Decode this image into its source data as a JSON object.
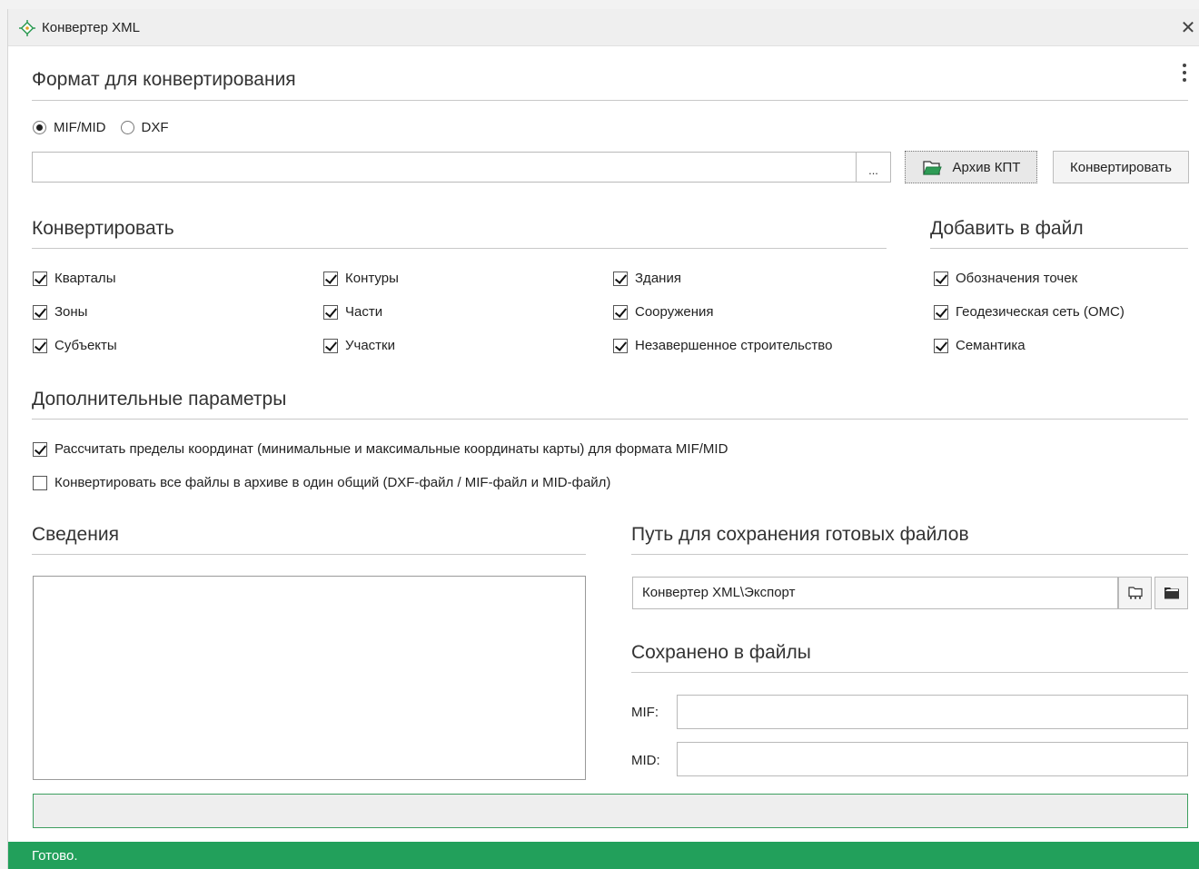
{
  "window": {
    "title": "Конвертер XML"
  },
  "format": {
    "heading": "Формат для конвертирования",
    "options": [
      {
        "label": "MIF/MID",
        "selected": true
      },
      {
        "label": "DXF",
        "selected": false
      }
    ],
    "file_path": "",
    "browse_label": "...",
    "archive_button": "Архив КПТ",
    "convert_button": "Конвертировать"
  },
  "convert": {
    "heading": "Конвертировать",
    "items": [
      {
        "label": "Кварталы",
        "checked": true
      },
      {
        "label": "Зоны",
        "checked": true
      },
      {
        "label": "Субъекты",
        "checked": true
      },
      {
        "label": "Контуры",
        "checked": true
      },
      {
        "label": "Части",
        "checked": true
      },
      {
        "label": "Участки",
        "checked": true
      },
      {
        "label": "Здания",
        "checked": true
      },
      {
        "label": "Сооружения",
        "checked": true
      },
      {
        "label": "Незавершенное строительство",
        "checked": true
      }
    ]
  },
  "add_to_file": {
    "heading": "Добавить в файл",
    "items": [
      {
        "label": "Обозначения точек",
        "checked": true
      },
      {
        "label": "Геодезическая сеть (ОМС)",
        "checked": true
      },
      {
        "label": "Семантика",
        "checked": true
      }
    ]
  },
  "extra": {
    "heading": "Дополнительные параметры",
    "items": [
      {
        "label": "Рассчитать пределы координат (минимальные и максимальные координаты карты) для формата MIF/MID",
        "checked": true
      },
      {
        "label": "Конвертировать все файлы в архиве в один общий (DXF-файл / MIF-файл и MID-файл)",
        "checked": false
      }
    ]
  },
  "info": {
    "heading": "Сведения",
    "text": ""
  },
  "save_path": {
    "heading": "Путь для сохранения готовых файлов",
    "value": "Конвертер XML\\Экспорт"
  },
  "saved": {
    "heading": "Сохранено в файлы",
    "mif_label": "MIF:",
    "mif_value": "",
    "mid_label": "MID:",
    "mid_value": ""
  },
  "status": {
    "text": "Готово."
  },
  "colors": {
    "accent": "#22a05b",
    "progress_border": "#3d9e5f"
  }
}
